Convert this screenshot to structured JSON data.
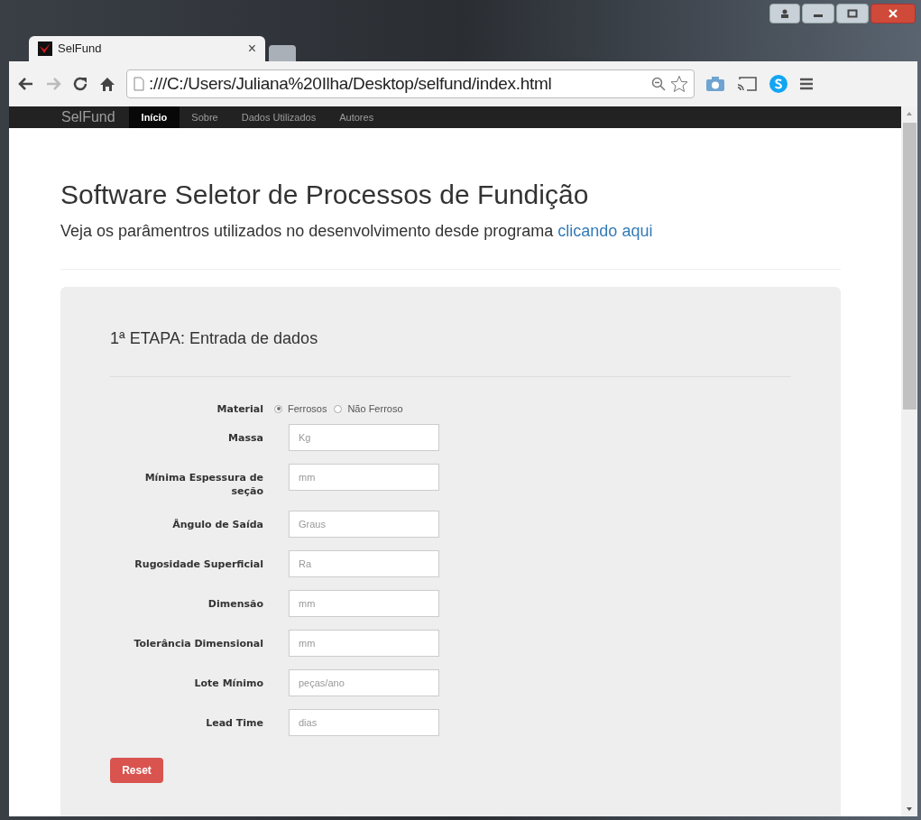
{
  "browser": {
    "tab_title": "SelFund",
    "tab_close": "×",
    "address": "​:///C:/Users/Juliana%20Ilha/Desktop/selfund/index.html"
  },
  "navbar": {
    "brand": "SelFund",
    "items": [
      {
        "label": "Início",
        "selected": true
      },
      {
        "label": "Sobre",
        "selected": false
      },
      {
        "label": "Dados Utilizados",
        "selected": false
      },
      {
        "label": "Autores",
        "selected": false
      }
    ]
  },
  "header": {
    "title": "Software Seletor de Processos de Fundição",
    "subtitle": "Veja os parâmentros utilizados no desenvolvimento desde programa",
    "link": "clicando aqui"
  },
  "panel": {
    "title": "1ª ETAPA: Entrada de dados",
    "material": {
      "label": "Material",
      "options": [
        {
          "label": "Ferrosos",
          "selected": true
        },
        {
          "label": "Não Ferroso",
          "selected": false
        }
      ]
    },
    "fields": [
      {
        "label": "Massa",
        "placeholder": "Kg"
      },
      {
        "label": "Mínima Espessura de seção",
        "placeholder": "mm"
      },
      {
        "label": "Ângulo de Saída",
        "placeholder": "Graus"
      },
      {
        "label": "Rugosidade Superficial",
        "placeholder": "Ra"
      },
      {
        "label": "Dimensão",
        "placeholder": "mm"
      },
      {
        "label": "Tolerância Dimensional",
        "placeholder": "mm"
      },
      {
        "label": "Lote Mínimo",
        "placeholder": "peças/ano"
      },
      {
        "label": "Lead Time",
        "placeholder": "dias"
      }
    ],
    "reset": "Reset"
  }
}
